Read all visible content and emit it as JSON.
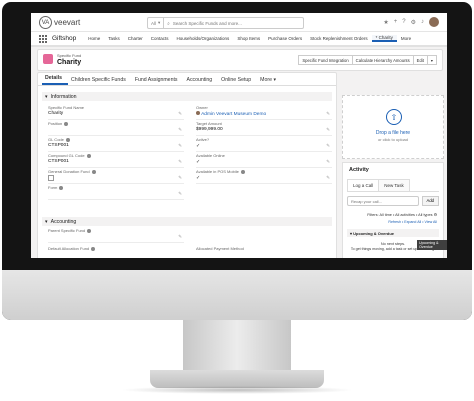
{
  "app": {
    "logo_text": "veevart",
    "app_name": "Giftshop",
    "search_scope": "All",
    "search_placeholder": "Search Specific Funds and more..."
  },
  "nav": {
    "items": [
      "Home",
      "Tasks",
      "Charter",
      "Contacts",
      "Households/Organizations",
      "Shop Items",
      "Purchase Orders",
      "Stock Replenishment Orders",
      "* Charity",
      "More"
    ]
  },
  "record": {
    "type_label": "Specific Fund",
    "title": "Charity",
    "buttons": [
      "Specific Fund Integration",
      "Calculate Hierarchy Amounts",
      "Edit"
    ]
  },
  "tabs": [
    "Details",
    "Children Specific Funds",
    "Fund Assignments",
    "Accounting",
    "Online Setup",
    "More"
  ],
  "information": {
    "heading": "Information",
    "fields": {
      "name_label": "Specific Fund Name",
      "name_value": "Charity",
      "owner_label": "Owner",
      "owner_value": "Admin Veevart Museum Demo",
      "position_label": "Position",
      "target_label": "Target Amount",
      "target_value": "$999,999.00",
      "gl_label": "GL Code",
      "gl_value": "CTSP001",
      "active_label": "Active?",
      "compound_label": "Compound GL Code",
      "compound_value": "CTSP001",
      "online_label": "Available Online",
      "general_label": "General Donation Fund",
      "pos_label": "Available in POS Mobile",
      "form_label": "Form"
    }
  },
  "accounting": {
    "heading": "Accounting",
    "parent_label": "Parent Specific Fund",
    "default_label": "Default Allocation Fund",
    "allocated_label": "Allocated Payment Method"
  },
  "upload": {
    "drop_text": "Drop a file here",
    "sub_text": "or click to upload"
  },
  "activity": {
    "title": "Activity",
    "tabs": [
      "Log a Call",
      "New Task"
    ],
    "input_placeholder": "Recap your call...",
    "add_label": "Add",
    "filters": "Filters: All time • All activities • All types",
    "refresh": "Refresh • Expand All • View All",
    "upcoming": "Upcoming & Overdue",
    "tooltip": "Upcoming & Overdue",
    "no_steps": "No next steps.",
    "no_steps_sub": "To get things moving, add a task or set up a meeting."
  }
}
